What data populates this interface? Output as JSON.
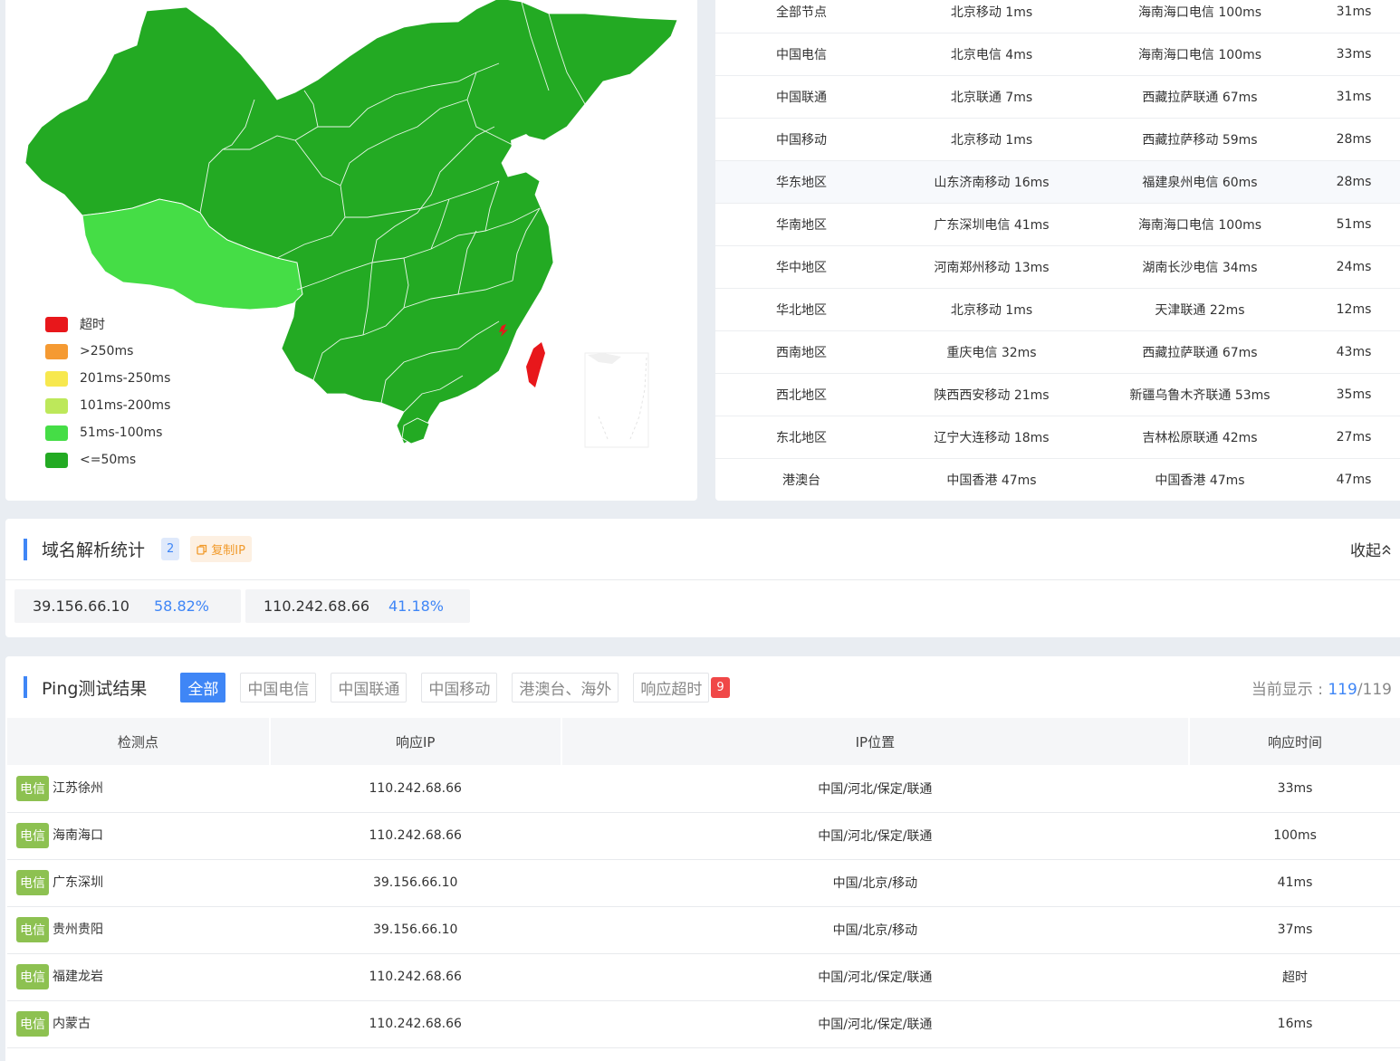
{
  "map": {
    "legend": [
      {
        "label": "超时",
        "color": "#e8171b"
      },
      {
        "label": ">250ms",
        "color": "#f59a32"
      },
      {
        "label": "201ms-250ms",
        "color": "#f7e84e"
      },
      {
        "label": "101ms-200ms",
        "color": "#bde85a"
      },
      {
        "label": "51ms-100ms",
        "color": "#45dd46"
      },
      {
        "label": "<=50ms",
        "color": "#23aa23"
      }
    ]
  },
  "region_table": {
    "rows": [
      {
        "region": "全部节点",
        "fastest": "北京移动 1ms",
        "slowest": "海南海口电信 100ms",
        "avg": "31ms"
      },
      {
        "region": "中国电信",
        "fastest": "北京电信 4ms",
        "slowest": "海南海口电信 100ms",
        "avg": "33ms"
      },
      {
        "region": "中国联通",
        "fastest": "北京联通 7ms",
        "slowest": "西藏拉萨联通 67ms",
        "avg": "31ms"
      },
      {
        "region": "中国移动",
        "fastest": "北京移动 1ms",
        "slowest": "西藏拉萨移动 59ms",
        "avg": "28ms"
      },
      {
        "region": "华东地区",
        "fastest": "山东济南移动 16ms",
        "slowest": "福建泉州电信 60ms",
        "avg": "28ms"
      },
      {
        "region": "华南地区",
        "fastest": "广东深圳电信 41ms",
        "slowest": "海南海口电信 100ms",
        "avg": "51ms"
      },
      {
        "region": "华中地区",
        "fastest": "河南郑州移动 13ms",
        "slowest": "湖南长沙电信 34ms",
        "avg": "24ms"
      },
      {
        "region": "华北地区",
        "fastest": "北京移动 1ms",
        "slowest": "天津联通 22ms",
        "avg": "12ms"
      },
      {
        "region": "西南地区",
        "fastest": "重庆电信 32ms",
        "slowest": "西藏拉萨联通 67ms",
        "avg": "43ms"
      },
      {
        "region": "西北地区",
        "fastest": "陕西西安移动 21ms",
        "slowest": "新疆乌鲁木齐联通 53ms",
        "avg": "35ms"
      },
      {
        "region": "东北地区",
        "fastest": "辽宁大连移动 18ms",
        "slowest": "吉林松原联通 42ms",
        "avg": "27ms"
      },
      {
        "region": "港澳台",
        "fastest": "中国香港 47ms",
        "slowest": "中国香港 47ms",
        "avg": "47ms"
      }
    ]
  },
  "dns": {
    "title": "域名解析统计",
    "count": "2",
    "copy_label": "复制IP",
    "collapse_label": "收起",
    "items": [
      {
        "ip": "39.156.66.10",
        "percent": "58.82%"
      },
      {
        "ip": "110.242.68.66",
        "percent": "41.18%"
      }
    ]
  },
  "ping": {
    "title": "Ping测试结果",
    "tabs": [
      "全部",
      "中国电信",
      "中国联通",
      "中国移动",
      "港澳台、海外",
      "响应超时"
    ],
    "timeout_count": "9",
    "display_label": "当前显示 : ",
    "display_current": "119",
    "display_sep": "/",
    "display_total": "119",
    "columns": [
      "检测点",
      "响应IP",
      "IP位置",
      "响应时间"
    ],
    "rows": [
      {
        "isp": "电信",
        "node": "江苏徐州",
        "ip": "110.242.68.66",
        "location": "中国/河北/保定/联通",
        "time": "33ms",
        "timeout": false
      },
      {
        "isp": "电信",
        "node": "海南海口",
        "ip": "110.242.68.66",
        "location": "中国/河北/保定/联通",
        "time": "100ms",
        "timeout": false
      },
      {
        "isp": "电信",
        "node": "广东深圳",
        "ip": "39.156.66.10",
        "location": "中国/北京/移动",
        "time": "41ms",
        "timeout": false
      },
      {
        "isp": "电信",
        "node": "贵州贵阳",
        "ip": "39.156.66.10",
        "location": "中国/北京/移动",
        "time": "37ms",
        "timeout": false
      },
      {
        "isp": "电信",
        "node": "福建龙岩",
        "ip": "110.242.68.66",
        "location": "中国/河北/保定/联通",
        "time": "超时",
        "timeout": true
      },
      {
        "isp": "电信",
        "node": "内蒙古",
        "ip": "110.242.68.66",
        "location": "中国/河北/保定/联通",
        "time": "16ms",
        "timeout": false
      }
    ]
  }
}
